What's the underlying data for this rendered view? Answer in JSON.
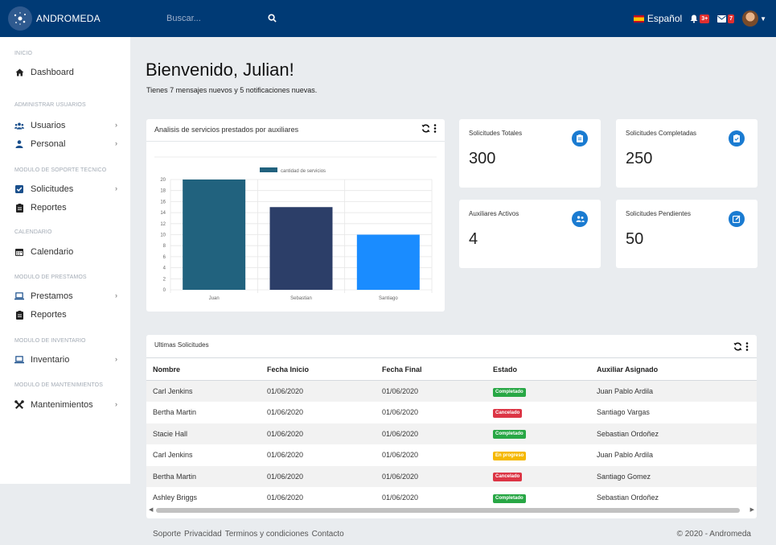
{
  "brand": {
    "name": "ANDROMEDA"
  },
  "search": {
    "placeholder": "Buscar..."
  },
  "topnav": {
    "language": "Español",
    "notifications_badge": "3+",
    "messages_badge": "7"
  },
  "sidebar": {
    "sections": [
      {
        "heading": "INICIO",
        "items": [
          {
            "label": "Dashboard",
            "icon": "home-icon"
          }
        ]
      },
      {
        "heading": "ADMINISTRAR USUARIOS",
        "items": [
          {
            "label": "Usuarios",
            "icon": "users-icon"
          },
          {
            "label": "Personal",
            "icon": "user-icon"
          }
        ]
      },
      {
        "heading": "MODULO DE SOPORTE TECNICO",
        "items": [
          {
            "label": "Solicitudes",
            "icon": "checkbox-icon"
          },
          {
            "label": "Reportes",
            "icon": "clipboard-icon"
          }
        ]
      },
      {
        "heading": "CALENDARIO",
        "items": [
          {
            "label": "Calendario",
            "icon": "calendar-icon"
          }
        ]
      },
      {
        "heading": "MODULO DE PRESTAMOS",
        "items": [
          {
            "label": "Prestamos",
            "icon": "laptop-icon"
          },
          {
            "label": "Reportes",
            "icon": "clipboard-icon"
          }
        ]
      },
      {
        "heading": "MODULO DE INVENTARIO",
        "items": [
          {
            "label": "Inventario",
            "icon": "laptop-icon"
          }
        ]
      },
      {
        "heading": "MODULO DE MANTENIMIENTOS",
        "items": [
          {
            "label": "Mantenimientos",
            "icon": "tools-icon"
          }
        ]
      }
    ]
  },
  "welcome": {
    "title": "Bienvenido, Julian!",
    "subtitle": "Tienes 7 mensajes nuevos y 5 notificaciones nuevas."
  },
  "chart_card": {
    "title": "Analisis de servicios prestados por auxiliares"
  },
  "chart_data": {
    "type": "bar",
    "categories": [
      "Juan",
      "Sebastian",
      "Santiago"
    ],
    "series": [
      {
        "name": "cantidad de servicios",
        "values": [
          20,
          15,
          10
        ]
      }
    ],
    "colors": [
      "#21627e",
      "#2c3e68",
      "#1a8cff"
    ],
    "legend_color": "#21627e",
    "yticks": [
      0,
      2,
      4,
      6,
      8,
      10,
      12,
      14,
      16,
      18,
      20
    ],
    "ylim": [
      0,
      20
    ],
    "grid": true,
    "legend_position": "top"
  },
  "stats": [
    {
      "label": "Solicitudes Totales",
      "value": "300",
      "icon": "clipboard-icon"
    },
    {
      "label": "Solicitudes Completadas",
      "value": "250",
      "icon": "clipboard-check-icon"
    },
    {
      "label": "Auxiliares Activos",
      "value": "4",
      "icon": "users-icon"
    },
    {
      "label": "Solicitudes Pendientes",
      "value": "50",
      "icon": "edit-icon"
    }
  ],
  "table": {
    "title": "Ultimas Solicitudes",
    "columns": [
      "Nombre",
      "Fecha Inicio",
      "Fecha Final",
      "Estado",
      "Auxiliar Asignado"
    ],
    "rows": [
      {
        "nombre": "Carl Jenkins",
        "inicio": "01/06/2020",
        "final": "01/06/2020",
        "estado": "Completado",
        "estado_color": "#28a745",
        "auxiliar": "Juan Pablo Ardila"
      },
      {
        "nombre": "Bertha Martin",
        "inicio": "01/06/2020",
        "final": "01/06/2020",
        "estado": "Cancelado",
        "estado_color": "#dc3545",
        "auxiliar": "Santiago Vargas"
      },
      {
        "nombre": "Stacie Hall",
        "inicio": "01/06/2020",
        "final": "01/06/2020",
        "estado": "Completado",
        "estado_color": "#28a745",
        "auxiliar": "Sebastian Ordoñez"
      },
      {
        "nombre": "Carl Jenkins",
        "inicio": "01/06/2020",
        "final": "01/06/2020",
        "estado": "En progreso",
        "estado_color": "#f5b800",
        "auxiliar": "Juan Pablo Ardila"
      },
      {
        "nombre": "Bertha Martin",
        "inicio": "01/06/2020",
        "final": "01/06/2020",
        "estado": "Cancelado",
        "estado_color": "#dc3545",
        "auxiliar": "Santiago Gomez"
      },
      {
        "nombre": "Ashley Briggs",
        "inicio": "01/06/2020",
        "final": "01/06/2020",
        "estado": "Completado",
        "estado_color": "#28a745",
        "auxiliar": "Sebastian Ordoñez"
      }
    ]
  },
  "footer": {
    "links": [
      "Soporte",
      "Privacidad",
      "Terminos y condiciones",
      "Contacto"
    ],
    "copyright": "© 2020 - Andromeda"
  }
}
